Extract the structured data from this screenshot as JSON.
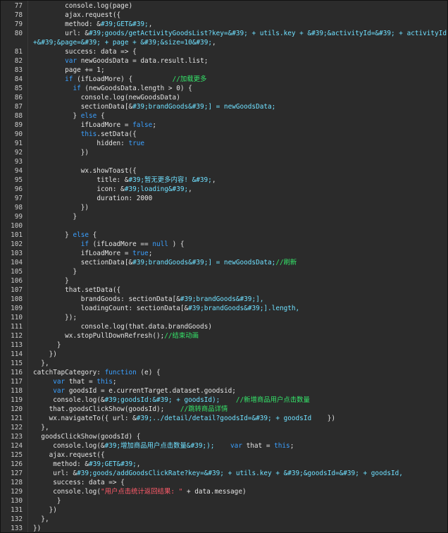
{
  "editor": {
    "lines": [
      {
        "n": "77",
        "segs": [
          [
            "",
            "        console.log(page)"
          ]
        ]
      },
      {
        "n": "78",
        "segs": [
          [
            "",
            "        ajax.request({"
          ]
        ]
      },
      {
        "n": "79",
        "segs": [
          [
            "",
            "        method: &"
          ],
          [
            "strb",
            "#39;GET&#39;"
          ],
          [
            "",
            ","
          ]
        ]
      },
      {
        "n": "80",
        "wrap": true,
        "segs": [
          [
            "",
            "        url: &"
          ],
          [
            "strb",
            "#39;goods/getActivityGoodsList?key=&#39; + utils.key + &#39;&activityId=&#39; + activityId+&#39;&page=&#39; + page + &#39;&size=10&#39;"
          ],
          [
            "",
            ","
          ]
        ]
      },
      {
        "n": "81",
        "segs": [
          [
            "",
            "        success: data => {"
          ]
        ]
      },
      {
        "n": "82",
        "segs": [
          [
            "kw",
            "        var"
          ],
          [
            "",
            " newGoodsData = data.result.list;"
          ]
        ]
      },
      {
        "n": "83",
        "segs": [
          [
            "",
            "        page += 1;"
          ]
        ]
      },
      {
        "n": "84",
        "segs": [
          [
            "kw",
            "        if"
          ],
          [
            "",
            " (ifLoadMore) {          "
          ],
          [
            "cm",
            "//加载更多"
          ]
        ]
      },
      {
        "n": "85",
        "segs": [
          [
            "kw",
            "          if"
          ],
          [
            "",
            " (newGoodsData.length > 0) {"
          ]
        ]
      },
      {
        "n": "86",
        "segs": [
          [
            "",
            "            console.log(newGoodsData)"
          ]
        ]
      },
      {
        "n": "87",
        "segs": [
          [
            "",
            "            sectionData[&"
          ],
          [
            "strb",
            "#39;brandGoods&#39;] = newGoodsData;"
          ]
        ]
      },
      {
        "n": "88",
        "segs": [
          [
            "",
            "          } "
          ],
          [
            "kw",
            "else"
          ],
          [
            "",
            " {"
          ]
        ]
      },
      {
        "n": "89",
        "segs": [
          [
            "",
            "            ifLoadMore = "
          ],
          [
            "kw",
            "false"
          ],
          [
            "",
            ";"
          ]
        ]
      },
      {
        "n": "90",
        "segs": [
          [
            "kw",
            "            this"
          ],
          [
            "",
            ".setData({"
          ]
        ]
      },
      {
        "n": "91",
        "segs": [
          [
            "",
            "                hidden: "
          ],
          [
            "kw",
            "true"
          ]
        ]
      },
      {
        "n": "92",
        "segs": [
          [
            "",
            "            })"
          ]
        ]
      },
      {
        "n": "93",
        "segs": [
          [
            "",
            ""
          ]
        ]
      },
      {
        "n": "94",
        "segs": [
          [
            "",
            "            wx.showToast({"
          ]
        ]
      },
      {
        "n": "95",
        "segs": [
          [
            "",
            "                title: &"
          ],
          [
            "strb",
            "#39;暂无更多内容! &#39;"
          ],
          [
            "",
            ","
          ]
        ]
      },
      {
        "n": "96",
        "segs": [
          [
            "",
            "                icon: &"
          ],
          [
            "strb",
            "#39;loading&#39;"
          ],
          [
            "",
            ","
          ]
        ]
      },
      {
        "n": "97",
        "segs": [
          [
            "",
            "                duration: 2000"
          ]
        ]
      },
      {
        "n": "98",
        "segs": [
          [
            "",
            "            })"
          ]
        ]
      },
      {
        "n": "99",
        "segs": [
          [
            "",
            "          }"
          ]
        ]
      },
      {
        "n": "100",
        "segs": [
          [
            "",
            ""
          ]
        ]
      },
      {
        "n": "101",
        "segs": [
          [
            "",
            "        } "
          ],
          [
            "kw",
            "else"
          ],
          [
            "",
            " {"
          ]
        ]
      },
      {
        "n": "102",
        "segs": [
          [
            "kw",
            "            if"
          ],
          [
            "",
            " (ifLoadMore == "
          ],
          [
            "kw",
            "null"
          ],
          [
            "",
            " ) {"
          ]
        ]
      },
      {
        "n": "103",
        "segs": [
          [
            "",
            "            ifLoadMore = "
          ],
          [
            "kw",
            "true"
          ],
          [
            "",
            ";"
          ]
        ]
      },
      {
        "n": "104",
        "segs": [
          [
            "",
            "            sectionData[&"
          ],
          [
            "strb",
            "#39;brandGoods&#39;] = newGoodsData;"
          ],
          [
            "cm",
            "//刷新"
          ]
        ]
      },
      {
        "n": "105",
        "segs": [
          [
            "",
            "          }"
          ]
        ]
      },
      {
        "n": "106",
        "segs": [
          [
            "",
            "        }"
          ]
        ]
      },
      {
        "n": "107",
        "segs": [
          [
            "",
            "        that.setData({"
          ]
        ]
      },
      {
        "n": "108",
        "segs": [
          [
            "",
            "            brandGoods: sectionData[&"
          ],
          [
            "strb",
            "#39;brandGoods&#39;],"
          ]
        ]
      },
      {
        "n": "109",
        "segs": [
          [
            "",
            "            loadingCount: sectionData[&"
          ],
          [
            "strb",
            "#39;brandGoods&#39;].length,"
          ]
        ]
      },
      {
        "n": "110",
        "segs": [
          [
            "",
            "        });"
          ]
        ]
      },
      {
        "n": "111",
        "segs": [
          [
            "",
            "            console.log(that.data.brandGoods)"
          ]
        ]
      },
      {
        "n": "112",
        "segs": [
          [
            "",
            "        wx.stopPullDownRefresh();"
          ],
          [
            "cm",
            "//结束动画"
          ]
        ]
      },
      {
        "n": "113",
        "segs": [
          [
            "",
            "      }"
          ]
        ]
      },
      {
        "n": "114",
        "segs": [
          [
            "",
            "    })"
          ]
        ]
      },
      {
        "n": "115",
        "segs": [
          [
            "",
            "  },"
          ]
        ]
      },
      {
        "n": "116",
        "segs": [
          [
            "",
            "catchTapCategory: "
          ],
          [
            "kw",
            "function"
          ],
          [
            "",
            " (e) {"
          ]
        ]
      },
      {
        "n": "117",
        "segs": [
          [
            "kw",
            "     var"
          ],
          [
            "",
            " that = "
          ],
          [
            "kw",
            "this"
          ],
          [
            "",
            ";"
          ]
        ]
      },
      {
        "n": "118",
        "segs": [
          [
            "kw",
            "     var"
          ],
          [
            "",
            " goodsId = e.currentTarget.dataset.goodsid;"
          ]
        ]
      },
      {
        "n": "119",
        "segs": [
          [
            "",
            "     console.log(&"
          ],
          [
            "strb",
            "#39;goodsId:&#39; + goodsId);"
          ],
          [
            "",
            "    "
          ],
          [
            "cm",
            "//新增商品用户点击数量"
          ]
        ]
      },
      {
        "n": "120",
        "segs": [
          [
            "",
            "    that.goodsClickShow(goodsId);    "
          ],
          [
            "cm",
            "//跳转商品详情"
          ]
        ]
      },
      {
        "n": "121",
        "segs": [
          [
            "",
            "    wx.navigateTo({ url: &"
          ],
          [
            "strb",
            "#39;../detail/detail?goodsId=&#39; + goodsId    "
          ],
          [
            "",
            "})"
          ]
        ]
      },
      {
        "n": "122",
        "segs": [
          [
            "",
            "  },"
          ]
        ]
      },
      {
        "n": "123",
        "segs": [
          [
            "",
            "  goodsClickShow(goodsId) {"
          ]
        ]
      },
      {
        "n": "124",
        "segs": [
          [
            "",
            "     console.log(&"
          ],
          [
            "strb",
            "#39;增加商品用户点击数量&#39;);"
          ],
          [
            "",
            "    "
          ],
          [
            "kw",
            "var"
          ],
          [
            "",
            " that = "
          ],
          [
            "kw",
            "this"
          ],
          [
            "",
            ";"
          ]
        ]
      },
      {
        "n": "125",
        "segs": [
          [
            "",
            "    ajax.request({"
          ]
        ]
      },
      {
        "n": "126",
        "segs": [
          [
            "",
            "     method: &"
          ],
          [
            "strb",
            "#39;GET&#39;"
          ],
          [
            "",
            ","
          ]
        ]
      },
      {
        "n": "127",
        "segs": [
          [
            "",
            "     url: &"
          ],
          [
            "strb",
            "#39;goods/addGoodsClickRate?key=&#39; + utils.key + &#39;&goodsId=&#39; + goodsId,"
          ]
        ]
      },
      {
        "n": "128",
        "segs": [
          [
            "",
            "     success: data => {"
          ]
        ]
      },
      {
        "n": "129",
        "segs": [
          [
            "",
            "     console.log("
          ],
          [
            "cmr",
            "\"用户点击统计返回结果: \""
          ],
          [
            "",
            " + data.message)"
          ]
        ]
      },
      {
        "n": "130",
        "segs": [
          [
            "",
            "      }"
          ]
        ]
      },
      {
        "n": "131",
        "segs": [
          [
            "",
            "    })"
          ]
        ]
      },
      {
        "n": "132",
        "segs": [
          [
            "",
            "  },"
          ]
        ]
      },
      {
        "n": "133",
        "segs": [
          [
            "",
            "})"
          ]
        ]
      }
    ]
  },
  "colors": {
    "background": "#2b2b2b",
    "keyword": "#3ba0ff",
    "string": "#6fe0ff",
    "comment": "#35e56a",
    "string_red": "#ff5b6a"
  }
}
